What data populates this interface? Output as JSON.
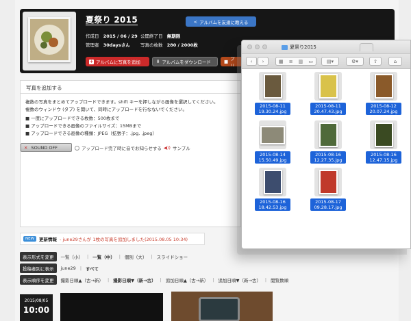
{
  "album": {
    "title": "夏祭り 2015",
    "share_button": "アルバムを友達に教える",
    "created_label": "作成日",
    "created_value": "2015 / 06 / 29",
    "end_label": "公開終了日",
    "end_value": "無期限",
    "admin_label": "管理者",
    "admin_value": "30daysさん",
    "photos_label": "写真の枚数",
    "photos_value": "280 / 2000枚",
    "add_button": "アルバムに写真を追加",
    "download_button": "アルバムをダウンロード",
    "third_button": "プリ"
  },
  "add_panel": {
    "title": "写真を追加する",
    "lines": [
      "複数の写真をまとめてアップロードできます。shift キーを押しながら画像を選択してください。",
      "複数のウィンドウ (タブ) を開いて、同時にアップロードを行なないでください。",
      "■ 一度にアップロードできる枚数：500枚まで",
      "■ アップロードできる画像のファイルサイズ：15MBまで",
      "■ アップロードできる画像の種類：JPEG（拡張子：.jpg, .jpeg）"
    ],
    "sound_button": "SOUND OFF",
    "sound_option": "アップロード完了時に音でお知らせする",
    "sample_link": "サンプル"
  },
  "news": {
    "badge": "NEW",
    "label": "更新情報",
    "text": " - june29さんが 1枚の写真を追加しました(2015.08.05 10:34)"
  },
  "filters": {
    "display_label": "表示形式を変更",
    "display_options": [
      "一覧（小）",
      "一覧（中）",
      "個別（大）",
      "スライドショー"
    ],
    "contributor_label": "投稿者別に表示",
    "contributor_options": [
      "june29",
      "すべて"
    ],
    "order_label": "表示順序を変更",
    "order_options": [
      "撮影日順▲（古→新）",
      "撮影日順▼（新→古）",
      "追加日順▲（古→新）",
      "追加日順▼（新→古）",
      "閲覧数順"
    ]
  },
  "photo_group": {
    "date": "2015/08/05",
    "time": "10:00"
  },
  "finder": {
    "title": "夏祭り2015",
    "files": [
      {
        "name1": "2015-08-11",
        "name2": "19.30.24.jpg",
        "color": "#6a5a3e"
      },
      {
        "name1": "2015-08-11",
        "name2": "20.47.43.jpg",
        "color": "#d9c24a"
      },
      {
        "name1": "2015-08-12",
        "name2": "20.07.24.jpg",
        "color": "#8a5a2a"
      },
      {
        "name1": "2015-08-14",
        "name2": "15.50.49.jpg",
        "color": "#8d8a78"
      },
      {
        "name1": "2015-08-16",
        "name2": "12.27.35.jpg",
        "color": "#4f6a3a"
      },
      {
        "name1": "2015-08-16",
        "name2": "12.47.15.jpg",
        "color": "#3a4a22"
      },
      {
        "name1": "2015-08-16",
        "name2": "18.42.53.jpg",
        "color": "#3d4d6e"
      },
      {
        "name1": "2015-08-17",
        "name2": "09.28.17.jpg",
        "color": "#c0392b"
      }
    ]
  }
}
